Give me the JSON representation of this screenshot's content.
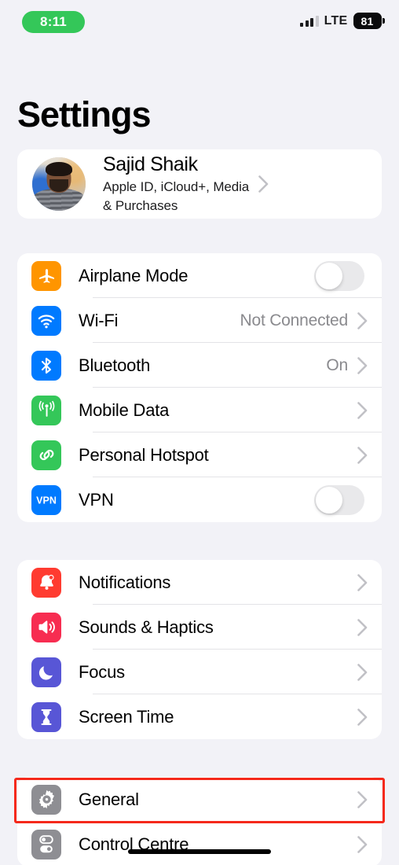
{
  "status_bar": {
    "time": "8:11",
    "time_pill_color": "#34C759",
    "network": "LTE",
    "battery_level": "81",
    "signal_bars_total": 4,
    "signal_bars_filled": 3
  },
  "header": {
    "title": "Settings"
  },
  "profile": {
    "name": "Sajid Shaik",
    "subtitle_line1": "Apple ID, iCloud+, Media",
    "subtitle_line2": "& Purchases",
    "avatar_alt": "profile-photo"
  },
  "groups": [
    {
      "id": "connectivity",
      "rows": [
        {
          "label": "Airplane Mode",
          "icon": "airplane-icon",
          "icon_color": "#FF9500",
          "accessory": "toggle",
          "toggle_on": false
        },
        {
          "label": "Wi-Fi",
          "icon": "wifi-icon",
          "icon_color": "#007AFF",
          "accessory": "chevron",
          "value": "Not Connected"
        },
        {
          "label": "Bluetooth",
          "icon": "bluetooth-icon",
          "icon_color": "#007AFF",
          "accessory": "chevron",
          "value": "On"
        },
        {
          "label": "Mobile Data",
          "icon": "antenna-icon",
          "icon_color": "#34C759",
          "accessory": "chevron",
          "value": ""
        },
        {
          "label": "Personal Hotspot",
          "icon": "hotspot-icon",
          "icon_color": "#34C759",
          "accessory": "chevron",
          "value": ""
        },
        {
          "label": "VPN",
          "icon": "vpn-icon",
          "icon_color": "#007AFF",
          "accessory": "toggle",
          "toggle_on": false
        }
      ]
    },
    {
      "id": "alerts",
      "rows": [
        {
          "label": "Notifications",
          "icon": "bell-icon",
          "icon_color": "#FF3B30",
          "accessory": "chevron",
          "value": ""
        },
        {
          "label": "Sounds & Haptics",
          "icon": "speaker-icon",
          "icon_color": "#F72D51",
          "accessory": "chevron",
          "value": ""
        },
        {
          "label": "Focus",
          "icon": "moon-icon",
          "icon_color": "#5856D6",
          "accessory": "chevron",
          "value": ""
        },
        {
          "label": "Screen Time",
          "icon": "hourglass-icon",
          "icon_color": "#5856D6",
          "accessory": "chevron",
          "value": ""
        }
      ]
    },
    {
      "id": "system",
      "rows": [
        {
          "label": "General",
          "icon": "gear-icon",
          "icon_color": "#8E8E93",
          "accessory": "chevron",
          "value": "",
          "highlighted": true
        },
        {
          "label": "Control Centre",
          "icon": "control-centre-icon",
          "icon_color": "#8E8E93",
          "accessory": "chevron",
          "value": ""
        }
      ]
    }
  ],
  "annotation": {
    "color": "#F5291B",
    "target": "General"
  }
}
